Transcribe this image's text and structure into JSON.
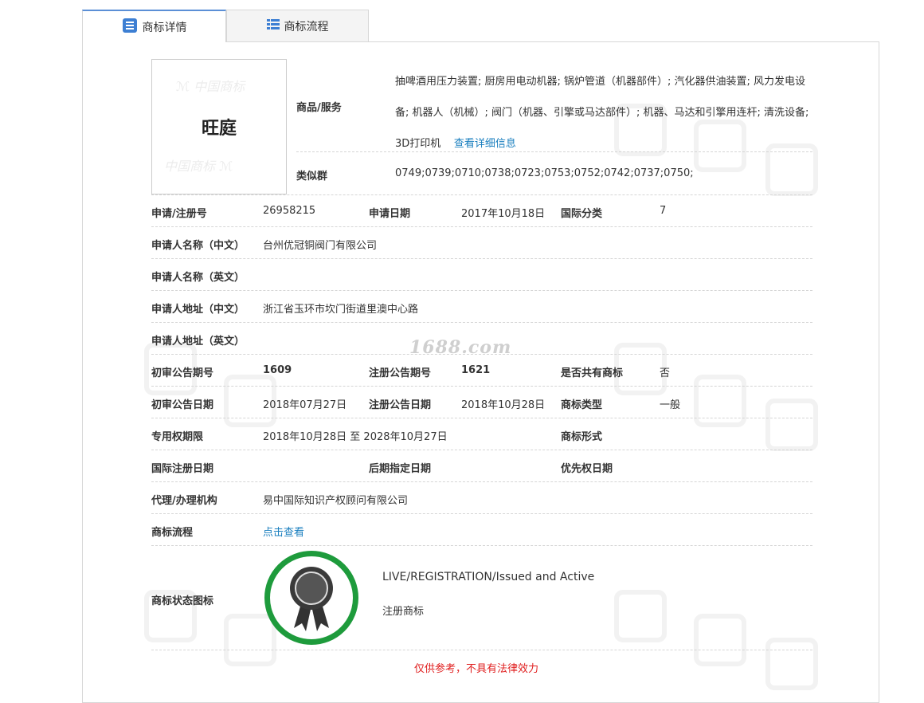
{
  "tabs": {
    "detail": "商标详情",
    "flow": "商标流程"
  },
  "watermark_text": "1688.com",
  "logo": {
    "text": "旺庭"
  },
  "goods": {
    "label": "商品/服务",
    "text": "抽啤酒用压力装置; 厨房用电动机器; 锅炉管道（机器部件）; 汽化器供油装置; 风力发电设备; 机器人（机械）; 阀门（机器、引擎或马达部件）; 机器、马达和引擎用连杆; 清洗设备; 3D打印机",
    "more_link": "查看详细信息"
  },
  "similar_group": {
    "label": "类似群",
    "value": "0749;0739;0710;0738;0723;0753;0752;0742;0737;0750;"
  },
  "rows": {
    "reg_no_label": "申请/注册号",
    "reg_no": "26958215",
    "apply_date_label": "申请日期",
    "apply_date": "2017年10月18日",
    "intl_class_label": "国际分类",
    "intl_class": "7",
    "applicant_cn_label": "申请人名称（中文）",
    "applicant_cn": "台州优冠铜阀门有限公司",
    "applicant_en_label": "申请人名称（英文）",
    "applicant_en": "",
    "address_cn_label": "申请人地址（中文）",
    "address_cn": "浙江省玉环市坎门街道里澳中心路",
    "address_en_label": "申请人地址（英文）",
    "address_en": "",
    "prelim_no_label": "初审公告期号",
    "prelim_no": "1609",
    "reg_pub_no_label": "注册公告期号",
    "reg_pub_no": "1621",
    "shared_label": "是否共有商标",
    "shared": "否",
    "prelim_date_label": "初审公告日期",
    "prelim_date": "2018年07月27日",
    "reg_pub_date_label": "注册公告日期",
    "reg_pub_date": "2018年10月28日",
    "type_label": "商标类型",
    "type": "一般",
    "term_label": "专用权期限",
    "term": "2018年10月28日 至 2028年10月27日",
    "form_label": "商标形式",
    "form": "",
    "intl_reg_date_label": "国际注册日期",
    "later_date_label": "后期指定日期",
    "priority_date_label": "优先权日期",
    "agency_label": "代理/办理机构",
    "agency": "易中国际知识产权顾问有限公司",
    "flow_label": "商标流程",
    "flow_link": "点击查看",
    "status_label": "商标状态图标",
    "status_en": "LIVE/REGISTRATION/Issued and Active",
    "status_cn": "注册商标"
  },
  "footer_note": "仅供参考，不具有法律效力",
  "colors": {
    "link": "#1a7fbf",
    "status_ring": "#1e9b3c",
    "warning": "#e02020",
    "tab_accent": "#5b8fd6"
  }
}
